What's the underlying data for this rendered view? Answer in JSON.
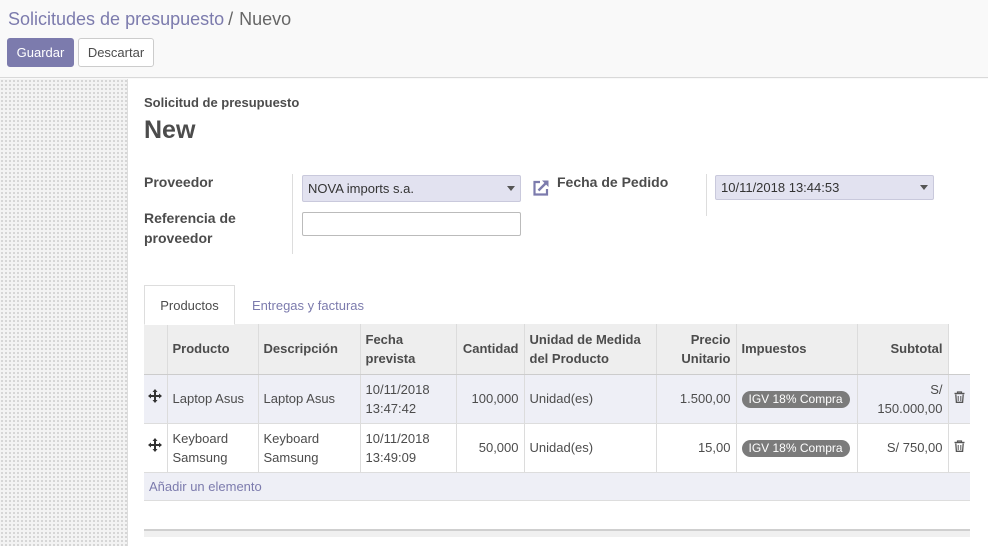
{
  "breadcrumb": {
    "parent": "Solicitudes de presupuesto",
    "separator": "/",
    "current": "Nuevo"
  },
  "buttons": {
    "save": "Guardar",
    "discard": "Descartar"
  },
  "form": {
    "title_label": "Solicitud de presupuesto",
    "title": "New",
    "proveedor_label": "Proveedor",
    "proveedor_value": "NOVA imports s.a.",
    "referencia_label_line1": "Referencia de",
    "referencia_label_line2": "proveedor",
    "referencia_value": "",
    "fecha_pedido_label": "Fecha de Pedido",
    "fecha_pedido_value": "10/11/2018 13:44:53"
  },
  "tabs": [
    {
      "label": "Productos",
      "active": true
    },
    {
      "label": "Entregas y facturas",
      "active": false
    }
  ],
  "table": {
    "headers": {
      "producto": "Producto",
      "descripcion": "Descripción",
      "fecha_l1": "Fecha",
      "fecha_l2": "prevista",
      "cantidad": "Cantidad",
      "unidad_l1": "Unidad de Medida",
      "unidad_l2": "del Producto",
      "precio_l1": "Precio",
      "precio_l2": "Unitario",
      "impuestos": "Impuestos",
      "subtotal": "Subtotal"
    },
    "rows": [
      {
        "producto_l1": "Laptop Asus",
        "producto_l2": "",
        "descripcion_l1": "Laptop Asus",
        "descripcion_l2": "",
        "fecha_l1": "10/11/2018",
        "fecha_l2": "13:47:42",
        "cantidad": "100,000",
        "unidad": "Unidad(es)",
        "precio": "1.500,00",
        "impuesto": "IGV 18% Compra",
        "subtotal": "S/ 150.000,00"
      },
      {
        "producto_l1": "Keyboard",
        "producto_l2": "Samsung",
        "descripcion_l1": "Keyboard",
        "descripcion_l2": "Samsung",
        "fecha_l1": "10/11/2018",
        "fecha_l2": "13:49:09",
        "cantidad": "50,000",
        "unidad": "Unidad(es)",
        "precio": "15,00",
        "impuesto": "IGV 18% Compra",
        "subtotal": "S/ 750,00"
      }
    ],
    "add_line": "Añadir un elemento"
  },
  "icons": {
    "external_link": "external-link-icon",
    "drag_handle": "arrows-move-icon",
    "delete": "trash-icon",
    "dropdown": "caret-down-icon"
  },
  "colors": {
    "accent": "#7c7bad",
    "selected_field_bg": "#e2e2f0",
    "badge_bg": "#7b7b7b"
  }
}
